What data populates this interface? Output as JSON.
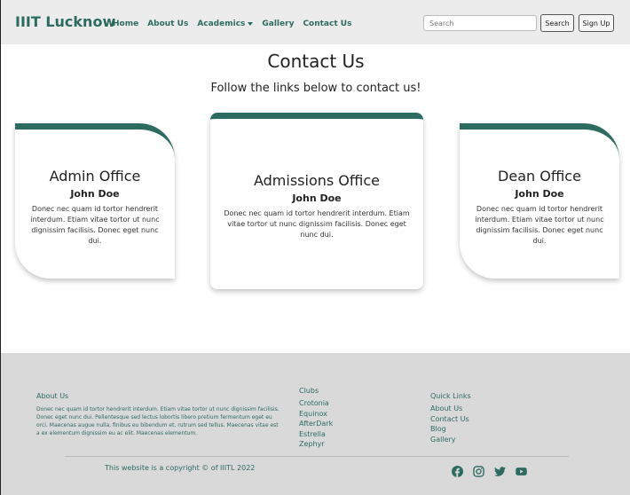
{
  "navbar": {
    "brand": "IIIT Lucknow",
    "links": [
      "Home",
      "About Us",
      "Academics",
      "Gallery",
      "Contact Us"
    ],
    "search_placeholder": "Search",
    "search_button": "Search",
    "signup_button": "Sign Up"
  },
  "main": {
    "title": "Contact Us",
    "subtitle": "Follow the links below to contact us!",
    "cards": [
      {
        "title": "Admin Office",
        "name": "John Doe",
        "text": "Donec nec quam id tortor hendrerit interdum. Etiam vitae tortor ut nunc dignissim facilisis. Donec eget nunc dui."
      },
      {
        "title": "Admissions Office",
        "name": "John Doe",
        "text": "Donec nec quam id tortor hendrerit interdum. Etiam vitae tortor ut nunc dignissim facilisis. Donec eget nunc dui."
      },
      {
        "title": "Dean Office",
        "name": "John Doe",
        "text": "Donec nec quam id tortor hendrerit interdum. Etiam vitae tortor ut nunc dignissim facilisis. Donec eget nunc dui."
      }
    ]
  },
  "footer": {
    "about_heading": "About Us",
    "about_text": "Donec nec quam id tortor hendrerit interdum. Etiam vitae tortor ut nunc dignissim facilisis. Donec eget nunc dui. Pellentesque sed lectus lobortis libero pretium fermentum eget eu orci. Maecenas augue nulla, finibus eu bibendum et, rutrum sed tellus. Maecenas vitae est a ex elementum dignissim eu ac elit. Maecenas elementum.",
    "clubs_heading": "Clubs",
    "clubs": [
      "Crotonia",
      "Equinox",
      "AfterDark",
      "Estrella",
      "Zephyr"
    ],
    "links_heading": "Quick Links",
    "links": [
      "About Us",
      "Contact Us",
      "Blog",
      "Gallery"
    ],
    "copyright": "This website is a copyright © of IIITL 2022",
    "socials": [
      "facebook-icon",
      "instagram-icon",
      "twitter-icon",
      "youtube-icon"
    ]
  },
  "colors": {
    "accent": "#2d6b60",
    "nav_bg": "#ececec",
    "footer_bg": "#d9d9d9"
  }
}
